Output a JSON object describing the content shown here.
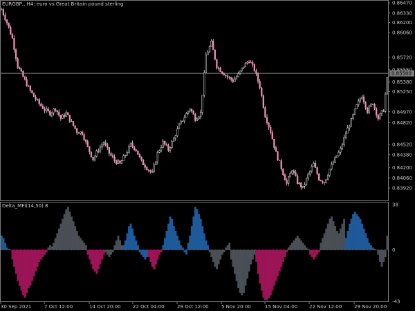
{
  "window": {
    "symbol_line": "EURGBP,, H4:  euro vs Great Britain pound sterling",
    "indicator_line": "Delta_MFI(14,50) 8"
  },
  "colors": {
    "background": "#000000",
    "grid_border": "#7c7c7c",
    "price_line": "#8a8a8a",
    "candle": "#e8e8e8",
    "candle_accent": "#f08cb4",
    "hist_blue": "#1e5a9a",
    "hist_gray": "#4a4f55",
    "hist_magenta": "#9b1456",
    "zero_line": "#707070"
  },
  "chart_data": [
    {
      "type": "candlestick",
      "title": "EURGBP,, H4:  euro vs Great Britain pound sterling",
      "ylim": [
        0.8375,
        0.865
      ],
      "y_ticks": [
        "0.86470",
        "0.86330",
        "0.86200",
        "0.86060",
        "0.85720",
        "0.85550",
        "0.85380",
        "0.85250",
        "0.84970",
        "0.84820",
        "0.84520",
        "0.84380",
        "0.84200",
        "0.84060",
        "0.83920"
      ],
      "current_price_label": "0.85500",
      "current_price": 0.855,
      "x_ticks": [
        "30 Sep 2021",
        "7 Oct 12:00",
        "14 Oct 20:00",
        "22 Oct 04:00",
        "29 Oct 12:00",
        "5 Nov 20:00",
        "15 Nov 04:00",
        "22 Nov 12:00",
        "29 Nov 20:00"
      ],
      "close_path": [
        [
          0,
          0.8638
        ],
        [
          3,
          0.862
        ],
        [
          6,
          0.8598
        ],
        [
          9,
          0.856
        ],
        [
          12,
          0.8545
        ],
        [
          15,
          0.853
        ],
        [
          18,
          0.8518
        ],
        [
          21,
          0.8508
        ],
        [
          24,
          0.85
        ],
        [
          27,
          0.8495
        ],
        [
          30,
          0.8502
        ],
        [
          33,
          0.8488
        ],
        [
          36,
          0.8495
        ],
        [
          39,
          0.8482
        ],
        [
          42,
          0.847
        ],
        [
          45,
          0.8468
        ],
        [
          48,
          0.8448
        ],
        [
          51,
          0.8432
        ],
        [
          54,
          0.8445
        ],
        [
          57,
          0.8455
        ],
        [
          60,
          0.844
        ],
        [
          63,
          0.843
        ],
        [
          66,
          0.8425
        ],
        [
          69,
          0.8438
        ],
        [
          72,
          0.8452
        ],
        [
          75,
          0.8445
        ],
        [
          78,
          0.8428
        ],
        [
          81,
          0.842
        ],
        [
          84,
          0.8412
        ],
        [
          87,
          0.844
        ],
        [
          90,
          0.8455
        ],
        [
          93,
          0.8445
        ],
        [
          96,
          0.846
        ],
        [
          99,
          0.8478
        ],
        [
          102,
          0.849
        ],
        [
          105,
          0.8502
        ],
        [
          108,
          0.8488
        ],
        [
          111,
          0.8495
        ],
        [
          114,
          0.8575
        ],
        [
          117,
          0.8592
        ],
        [
          120,
          0.856
        ],
        [
          123,
          0.8552
        ],
        [
          126,
          0.8545
        ],
        [
          129,
          0.854
        ],
        [
          132,
          0.8548
        ],
        [
          135,
          0.856
        ],
        [
          138,
          0.8568
        ],
        [
          141,
          0.8555
        ],
        [
          144,
          0.8532
        ],
        [
          147,
          0.8492
        ],
        [
          150,
          0.847
        ],
        [
          153,
          0.844
        ],
        [
          156,
          0.842
        ],
        [
          159,
          0.8398
        ],
        [
          162,
          0.8418
        ],
        [
          165,
          0.84
        ],
        [
          168,
          0.8392
        ],
        [
          171,
          0.841
        ],
        [
          174,
          0.8425
        ],
        [
          177,
          0.8405
        ],
        [
          180,
          0.84
        ],
        [
          183,
          0.8418
        ],
        [
          186,
          0.8432
        ],
        [
          189,
          0.8445
        ],
        [
          192,
          0.8468
        ],
        [
          195,
          0.8485
        ],
        [
          198,
          0.8505
        ],
        [
          201,
          0.852
        ],
        [
          204,
          0.8498
        ],
        [
          207,
          0.851
        ],
        [
          210,
          0.8488
        ],
        [
          213,
          0.85
        ],
        [
          215,
          0.8542
        ]
      ]
    },
    {
      "type": "bar",
      "title": "Delta_MFI(14,50) 8",
      "ylim": [
        -43,
        38
      ],
      "y_ticks": [
        "38",
        "0",
        "-43"
      ],
      "color_rule": "blue when value>=threshold rising, gray when weak, magenta when strongly negative",
      "segments": [
        {
          "from": 0,
          "to": 6,
          "color": "blue",
          "shape": [
            12,
            10,
            6,
            2,
            1,
            0
          ]
        },
        {
          "from": 6,
          "to": 26,
          "color": "magenta",
          "shape": [
            -8,
            -14,
            -20,
            -26,
            -30,
            -34,
            -38,
            -40,
            -36,
            -32,
            -30,
            -26,
            -22,
            -18,
            -14,
            -10,
            -8,
            -6,
            -4,
            -2
          ]
        },
        {
          "from": 26,
          "to": 29,
          "color": "gray",
          "shape": [
            2,
            4,
            3
          ]
        },
        {
          "from": 29,
          "to": 48,
          "color": "gray",
          "shape": [
            6,
            10,
            14,
            18,
            22,
            26,
            30,
            34,
            36,
            32,
            28,
            24,
            20,
            16,
            12,
            10,
            8,
            6,
            4
          ]
        },
        {
          "from": 48,
          "to": 58,
          "color": "magenta",
          "shape": [
            -4,
            -8,
            -12,
            -16,
            -18,
            -20,
            -16,
            -12,
            -8,
            -4
          ]
        },
        {
          "from": 58,
          "to": 68,
          "color": "gray",
          "shape": [
            -2,
            -4,
            -6,
            -4,
            -2,
            4,
            8,
            12,
            8,
            4
          ]
        },
        {
          "from": 68,
          "to": 82,
          "color": "blue",
          "shape": [
            4,
            8,
            14,
            20,
            22,
            18,
            12,
            8,
            4,
            -2,
            -4,
            -6,
            -8,
            -6
          ]
        },
        {
          "from": 82,
          "to": 90,
          "color": "magenta",
          "shape": [
            -6,
            -10,
            -14,
            -16,
            -12,
            -8,
            -4,
            -2
          ]
        },
        {
          "from": 90,
          "to": 104,
          "color": "blue",
          "shape": [
            4,
            10,
            16,
            22,
            28,
            26,
            20,
            16,
            12,
            8,
            4,
            2,
            -2,
            -4
          ]
        },
        {
          "from": 104,
          "to": 116,
          "color": "blue",
          "shape": [
            6,
            12,
            20,
            28,
            36,
            34,
            30,
            26,
            20,
            14,
            8,
            4
          ]
        },
        {
          "from": 116,
          "to": 128,
          "color": "gray",
          "shape": [
            -2,
            -6,
            -10,
            -14,
            -16,
            -12,
            -8,
            -4,
            -2,
            2,
            4,
            6
          ]
        },
        {
          "from": 128,
          "to": 142,
          "color": "gray",
          "shape": [
            -8,
            -14,
            -20,
            -26,
            -32,
            -36,
            -38,
            -36,
            -30,
            -24,
            -18,
            -12,
            -8,
            -4
          ]
        },
        {
          "from": 142,
          "to": 160,
          "color": "magenta",
          "shape": [
            -10,
            -20,
            -28,
            -34,
            -40,
            -42,
            -42,
            -40,
            -38,
            -34,
            -30,
            -26,
            -22,
            -18,
            -14,
            -10,
            -6,
            -2
          ]
        },
        {
          "from": 160,
          "to": 172,
          "color": "gray",
          "shape": [
            2,
            4,
            6,
            8,
            10,
            12,
            10,
            8,
            6,
            4,
            2,
            1
          ]
        },
        {
          "from": 172,
          "to": 178,
          "color": "magenta",
          "shape": [
            -4,
            -6,
            -8,
            -6,
            -4,
            -2
          ]
        },
        {
          "from": 178,
          "to": 192,
          "color": "gray",
          "shape": [
            6,
            10,
            14,
            18,
            22,
            26,
            28,
            24,
            20,
            16,
            14,
            18,
            22,
            26
          ]
        },
        {
          "from": 192,
          "to": 210,
          "color": "blue",
          "shape": [
            10,
            16,
            22,
            26,
            30,
            32,
            30,
            28,
            26,
            22,
            18,
            14,
            10,
            6,
            4,
            2,
            1,
            0
          ]
        },
        {
          "from": 210,
          "to": 216,
          "color": "gray",
          "shape": [
            -4,
            -10,
            -14,
            -10,
            -6,
            12
          ]
        }
      ]
    }
  ]
}
